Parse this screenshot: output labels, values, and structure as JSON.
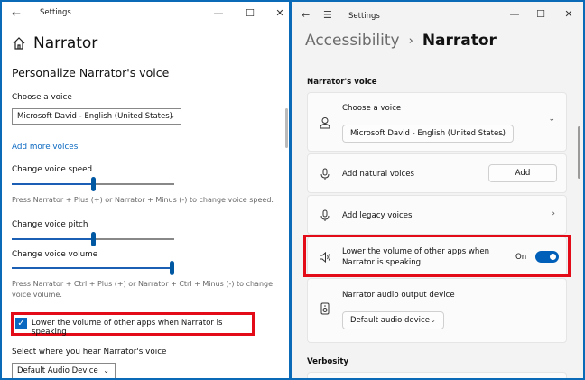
{
  "left": {
    "window_title": "Settings",
    "page_title": "Narrator",
    "section_title": "Personalize Narrator's voice",
    "choose_voice_label": "Choose a voice",
    "voice_value": "Microsoft David - English (United States)",
    "add_more_voices": "Add more voices",
    "speed_label": "Change voice speed",
    "speed_hint": "Press Narrator + Plus (+) or Narrator + Minus (-) to change voice speed.",
    "pitch_label": "Change voice pitch",
    "volume_label": "Change voice volume",
    "volume_hint": "Press Narrator + Ctrl + Plus (+) or Narrator + Ctrl + Minus (-) to change voice volume.",
    "lower_volume_label": "Lower the volume of other apps when Narrator is speaking",
    "lower_volume_checked": true,
    "output_label": "Select where you hear Narrator's voice",
    "output_value": "Default Audio Device",
    "speed_level": 0.5,
    "pitch_level": 0.5,
    "volume_level": 1.0
  },
  "right": {
    "window_title": "Settings",
    "breadcrumb_parent": "Accessibility",
    "breadcrumb_sep": "›",
    "breadcrumb_current": "Narrator",
    "section_voice": "Narrator's voice",
    "choose_voice_label": "Choose a voice",
    "voice_value": "Microsoft David - English (United States)",
    "natural_voices_label": "Add natural voices",
    "add_button": "Add",
    "legacy_voices_label": "Add legacy voices",
    "lower_volume_line1": "Lower the volume of other apps when",
    "lower_volume_line2": "Narrator is speaking",
    "toggle_state": "On",
    "output_device_label": "Narrator audio output device",
    "output_device_value": "Default audio device",
    "section_verbosity": "Verbosity"
  },
  "colors": {
    "accent": "#005fb8",
    "highlight": "#e30b17",
    "desktop": "#0a6ab8"
  }
}
